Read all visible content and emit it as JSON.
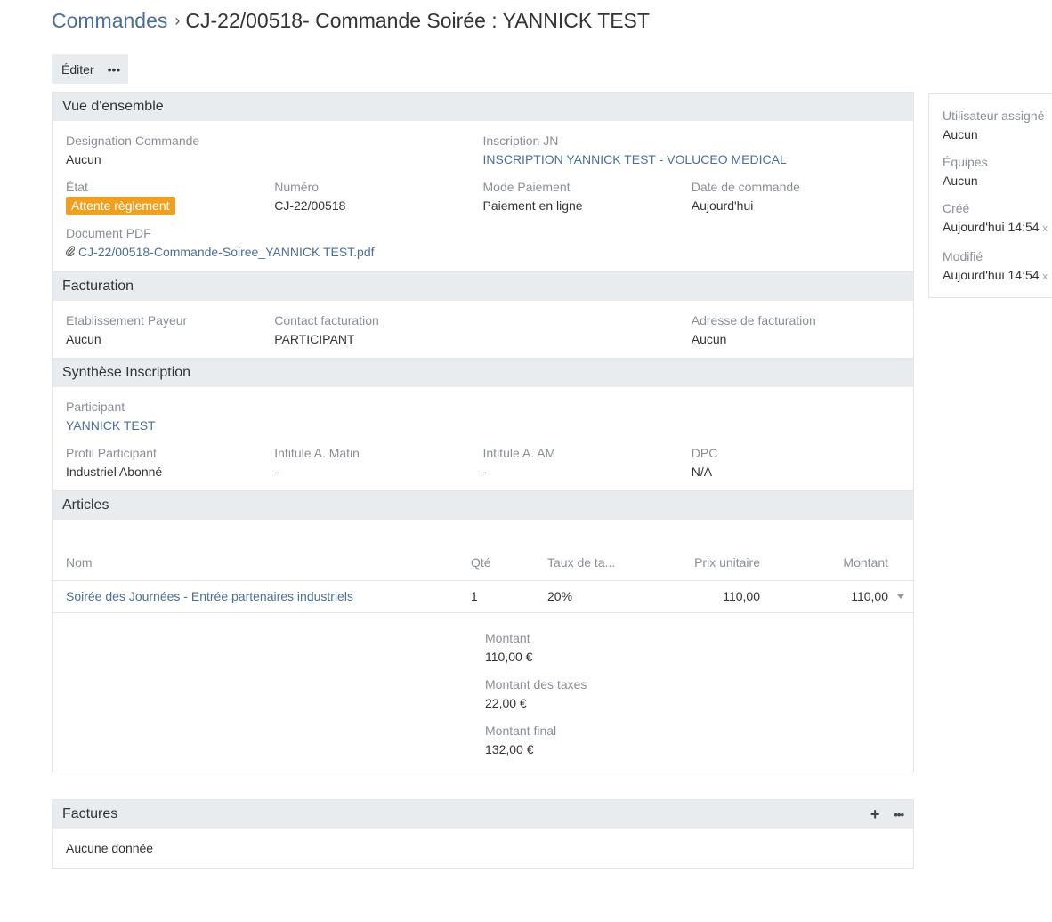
{
  "breadcrumb": {
    "parent": "Commandes",
    "separator": "›",
    "current": "CJ-22/00518- Commande Soirée : YANNICK TEST"
  },
  "toolbar": {
    "edit_label": "Éditer",
    "more_label": "•••"
  },
  "overview": {
    "title": "Vue d'ensemble",
    "designation_label": "Designation Commande",
    "designation_value": "Aucun",
    "inscription_label": "Inscription JN",
    "inscription_value": "INSCRIPTION YANNICK TEST - VOLUCEO MEDICAL",
    "etat_label": "État",
    "etat_value": "Attente règlement",
    "numero_label": "Numéro",
    "numero_value": "CJ-22/00518",
    "mode_label": "Mode Paiement",
    "mode_value": "Paiement en ligne",
    "date_label": "Date de commande",
    "date_value": "Aujourd'hui",
    "pdf_label": "Document PDF",
    "pdf_value": "CJ-22/00518-Commande-Soiree_YANNICK TEST.pdf"
  },
  "billing": {
    "title": "Facturation",
    "payer_label": "Etablissement Payeur",
    "payer_value": "Aucun",
    "contact_label": "Contact facturation",
    "contact_value": "PARTICIPANT",
    "address_label": "Adresse de facturation",
    "address_value": "Aucun"
  },
  "summary": {
    "title": "Synthèse Inscription",
    "participant_label": "Participant",
    "participant_value": "YANNICK TEST",
    "profil_label": "Profil Participant",
    "profil_value": "Industriel Abonné",
    "matin_label": "Intitule A. Matin",
    "matin_value": "-",
    "am_label": "Intitule A. AM",
    "am_value": "-",
    "dpc_label": "DPC",
    "dpc_value": "N/A"
  },
  "articles": {
    "title": "Articles",
    "columns": {
      "name": "Nom",
      "qty": "Qté",
      "tax": "Taux de ta...",
      "unit_price": "Prix unitaire",
      "amount": "Montant"
    },
    "rows": [
      {
        "name": "Soirée des Journées - Entrée partenaires industriels",
        "qty": "1",
        "tax": "20%",
        "unit_price": "110,00",
        "amount": "110,00"
      }
    ],
    "totals": {
      "amount_label": "Montant",
      "amount_value": "110,00 €",
      "tax_label": "Montant des taxes",
      "tax_value": "22,00 €",
      "final_label": "Montant final",
      "final_value": "132,00 €"
    }
  },
  "invoices": {
    "title": "Factures",
    "add_label": "+",
    "more_label": "•••",
    "empty_text": "Aucune donnée"
  },
  "sidebar": {
    "assigned_label": "Utilisateur assigné",
    "assigned_value": "Aucun",
    "teams_label": "Équipes",
    "teams_value": "Aucun",
    "created_label": "Créé",
    "created_value": "Aujourd'hui 14:54",
    "created_suffix": "x",
    "modified_label": "Modifié",
    "modified_value": "Aujourd'hui 14:54",
    "modified_suffix": "x"
  },
  "colors": {
    "link": "#4a6f9a",
    "badge": "#f0a020",
    "panel_header": "#e9ecef",
    "label": "#8a8f96"
  },
  "icons": {
    "attachment": "paperclip-icon",
    "caret": "caret-down-icon",
    "add": "plus-icon",
    "more": "ellipsis-icon"
  }
}
